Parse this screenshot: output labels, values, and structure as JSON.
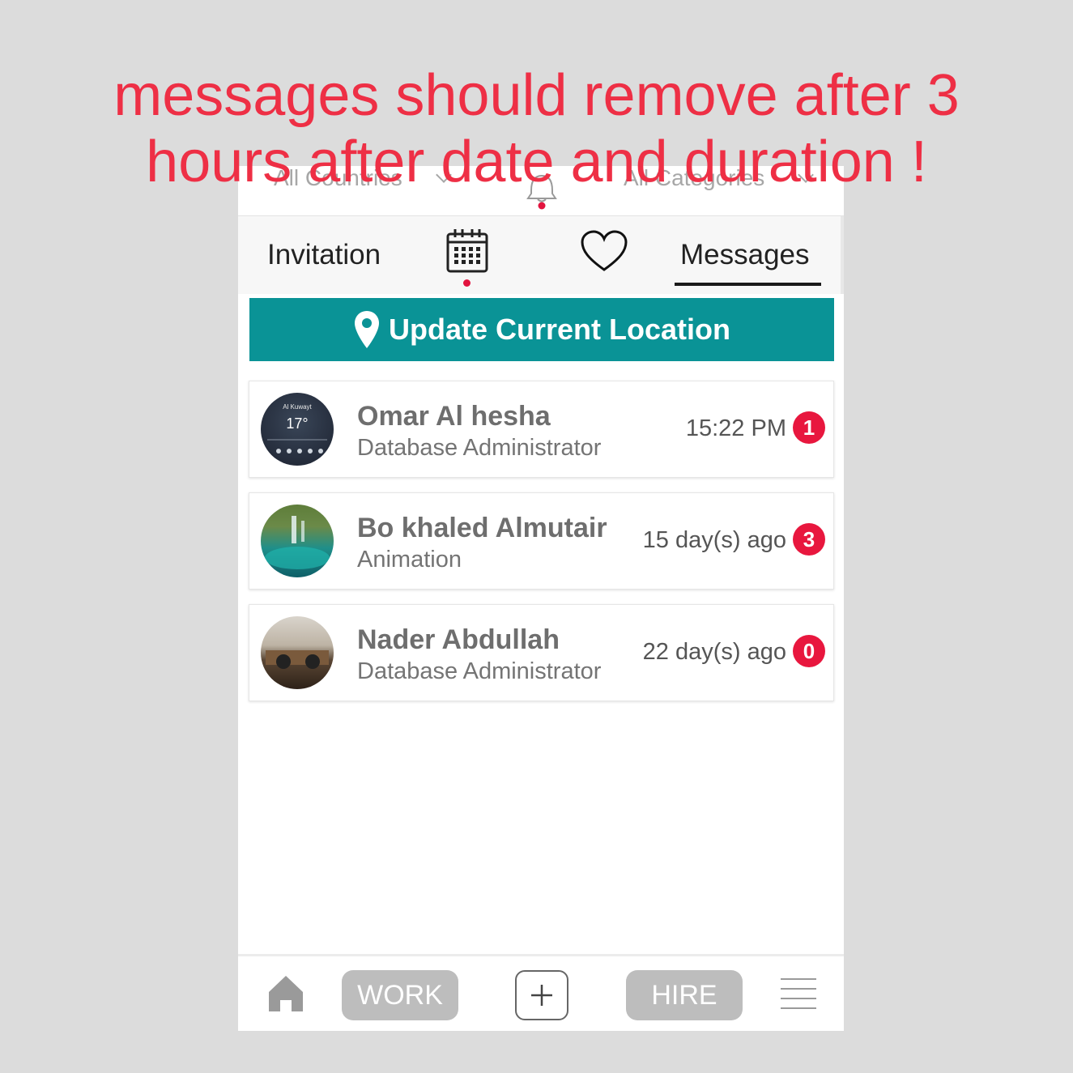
{
  "annotation": {
    "line1": "messages should remove after 3",
    "line2": "hours after date and duration !"
  },
  "filters": {
    "countries": "All Countries",
    "categories": "All Categories"
  },
  "tabs": {
    "invitation": "Invitation",
    "messages": "Messages"
  },
  "location_button": "Update Current Location",
  "conversations": [
    {
      "name": "Omar Al hesha",
      "role": "Database Administrator",
      "time": "15:22 PM",
      "unread": "1"
    },
    {
      "name": "Bo khaled Almutair",
      "role": "Animation",
      "time": "15 day(s) ago",
      "unread": "3"
    },
    {
      "name": "Nader Abdullah",
      "role": "Database Administrator",
      "time": "22 day(s) ago",
      "unread": "0"
    }
  ],
  "avatar_widget": {
    "city": "Al Kuwayt",
    "temp": "17°"
  },
  "bottom_nav": {
    "work": "WORK",
    "hire": "HIRE"
  },
  "colors": {
    "accent_teal": "#0a9396",
    "badge_red": "#e8173e",
    "annotation_red": "#ee2f45"
  },
  "icons": [
    "chevron-down-icon",
    "bell-icon",
    "calendar-icon",
    "heart-icon",
    "location-pin-icon",
    "home-icon",
    "plus-icon",
    "menu-icon"
  ]
}
